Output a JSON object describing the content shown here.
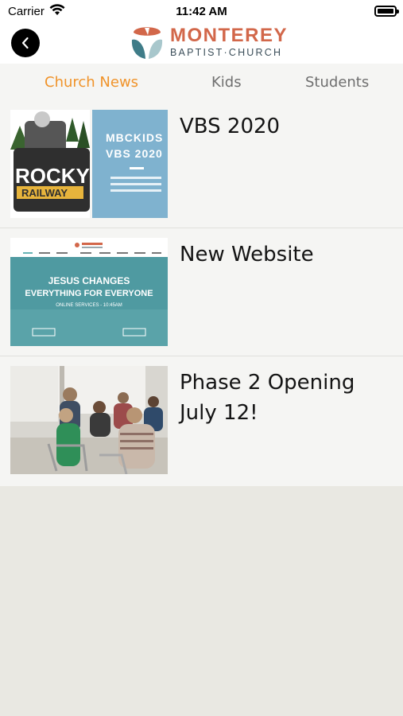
{
  "status_bar": {
    "carrier": "Carrier",
    "time": "11:42 AM",
    "wifi_icon": "wifi-icon",
    "battery_icon": "battery-icon"
  },
  "header": {
    "back_icon": "chevron-left-icon",
    "logo": {
      "line1": "MONTEREY",
      "line2": "BAPTIST·CHURCH"
    }
  },
  "tabs": [
    {
      "label": "Church News",
      "active": true
    },
    {
      "label": "Kids",
      "active": false
    },
    {
      "label": "Students",
      "active": false
    }
  ],
  "news": [
    {
      "title": "VBS 2020",
      "thumbnail": {
        "left_text1": "ROCKY",
        "left_text2": "RAILWAY",
        "right_title1": "MBCKIDS",
        "right_title2": "VBS 2020"
      }
    },
    {
      "title": "New Website",
      "thumbnail": {
        "headline1": "JESUS CHANGES",
        "headline2": "EVERYTHING FOR EVERYONE",
        "subline": "ONLINE SERVICES - 10:45AM"
      }
    },
    {
      "title": "Phase 2 Opening July 12!",
      "thumbnail": {}
    }
  ],
  "colors": {
    "accent": "#f0932a",
    "logo_orange": "#d2674a",
    "logo_teal": "#3f7c88",
    "tab_inactive": "#6f6f6f",
    "page_bg": "#e9e8e2"
  }
}
